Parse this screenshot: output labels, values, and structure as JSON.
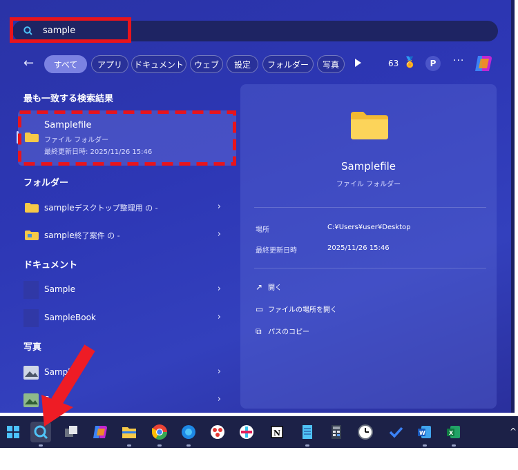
{
  "search": {
    "query": "sample"
  },
  "filters": {
    "chips": [
      "すべて",
      "アプリ",
      "ドキュメント",
      "ウェブ",
      "設定",
      "フォルダー",
      "写真"
    ],
    "count": "63",
    "avatar": "P",
    "more": "···"
  },
  "best_match": {
    "section_title": "最も一致する検索結果",
    "title": "Samplefile",
    "type": "ファイル フォルダー",
    "modified": "最終更新日時: 2025/11/26 15:46"
  },
  "folders": {
    "section_title": "フォルダー",
    "items": [
      {
        "name": "sample",
        "detail": "デスクトップ整理用 の -"
      },
      {
        "name": "sample",
        "detail": "終了案件 の -"
      }
    ]
  },
  "documents": {
    "section_title": "ドキュメント",
    "items": [
      "Sample",
      "SampleBook"
    ]
  },
  "photos": {
    "section_title": "写真",
    "items": [
      "Sample",
      "S"
    ]
  },
  "detail": {
    "title": "Samplefile",
    "subtitle": "ファイル フォルダー",
    "location_label": "場所",
    "location_value": "C:¥Users¥user¥Desktop",
    "modified_label": "最終更新日時",
    "modified_value": "2025/11/26 15:46",
    "actions": [
      "開く",
      "ファイルの場所を開く",
      "パスのコピー"
    ]
  },
  "colors": {
    "highlight_red": "#e8141c",
    "accent": "#7b82e2"
  },
  "taskbar": {
    "icons": [
      "windows-start-icon",
      "search-icon",
      "task-view-icon",
      "copilot-icon",
      "file-explorer-icon",
      "chrome-icon",
      "edge-icon",
      "app-icon",
      "slack-icon",
      "notion-icon",
      "notepad-icon",
      "calculator-icon",
      "clock-icon",
      "todo-icon",
      "word-icon",
      "excel-icon"
    ]
  }
}
